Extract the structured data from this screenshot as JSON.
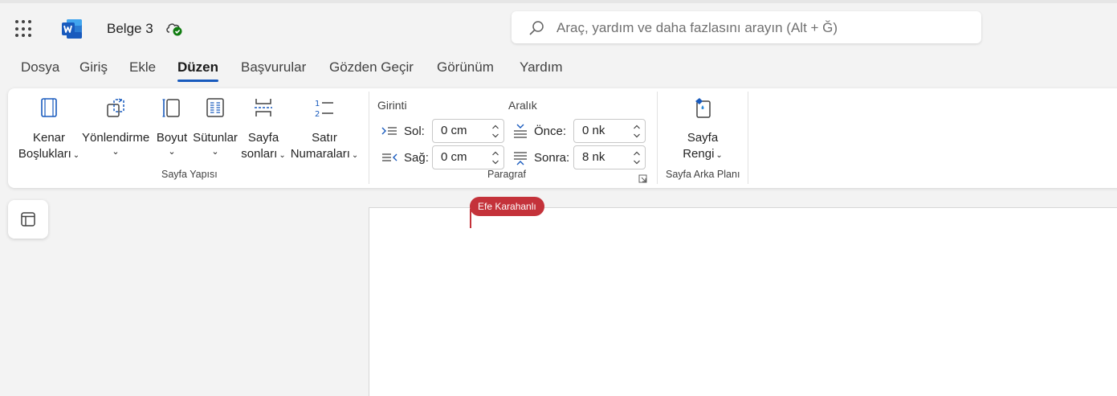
{
  "app": {
    "document_title": "Belge 3",
    "save_status": "saved"
  },
  "search": {
    "placeholder": "Araç, yardım ve daha fazlasını arayın (Alt + Ğ)"
  },
  "tabs": [
    {
      "label": "Dosya",
      "active": false
    },
    {
      "label": "Giriş",
      "active": false
    },
    {
      "label": "Ekle",
      "active": false
    },
    {
      "label": "Düzen",
      "active": true
    },
    {
      "label": "Başvurular",
      "active": false
    },
    {
      "label": "Gözden Geçir",
      "active": false
    },
    {
      "label": "Görünüm",
      "active": false
    },
    {
      "label": "Yardım",
      "active": false
    }
  ],
  "ribbon": {
    "page_setup": {
      "group_label": "Sayfa Yapısı",
      "margins": {
        "line1": "Kenar",
        "line2": "Boşlukları"
      },
      "orientation": {
        "label": "Yönlendirme"
      },
      "size": {
        "label": "Boyut"
      },
      "columns": {
        "label": "Sütunlar"
      },
      "breaks": {
        "line1": "Sayfa",
        "line2": "sonları"
      },
      "line_numbers": {
        "line1": "Satır",
        "line2": "Numaraları"
      }
    },
    "paragraph": {
      "group_label": "Paragraf",
      "indent": {
        "title": "Girinti",
        "left_label": "Sol:",
        "left_value": "0 cm",
        "right_label": "Sağ:",
        "right_value": "0 cm"
      },
      "spacing": {
        "title": "Aralık",
        "before_label": "Önce:",
        "before_value": "0 nk",
        "after_label": "Sonra:",
        "after_value": "8 nk"
      }
    },
    "page_background": {
      "group_label": "Sayfa Arka Planı",
      "page_color": {
        "line1": "Sayfa",
        "line2": "Rengi"
      }
    }
  },
  "document": {
    "collaborator_name": "Efe Karahanlı"
  },
  "colors": {
    "accent": "#185abd",
    "presence": "#c4323a",
    "word_blue": "#185abd",
    "saved_green": "#107c10"
  }
}
